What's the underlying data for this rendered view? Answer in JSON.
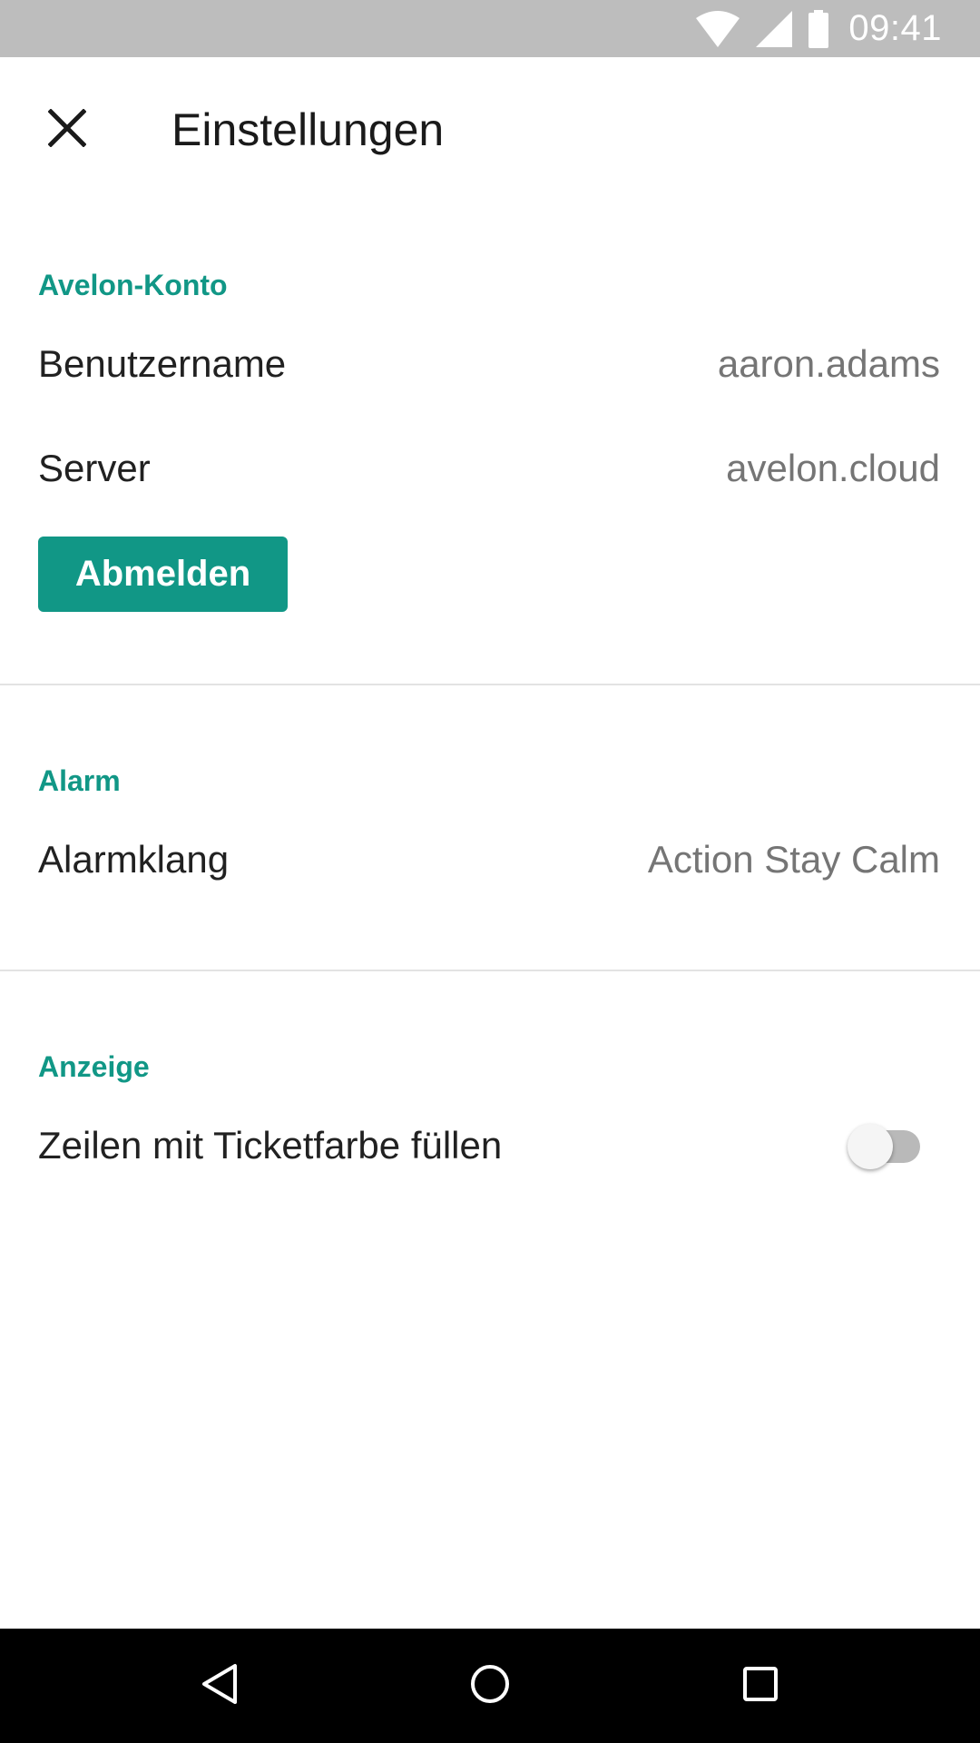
{
  "status_bar": {
    "time": "09:41",
    "icons": [
      "wifi-icon",
      "signal-icon",
      "battery-icon"
    ]
  },
  "app_bar": {
    "close_icon": "close-icon",
    "title": "Einstellungen"
  },
  "sections": {
    "account": {
      "header": "Avelon-Konto",
      "username_label": "Benutzername",
      "username_value": "aaron.adams",
      "server_label": "Server",
      "server_value": "avelon.cloud",
      "logout_label": "Abmelden"
    },
    "alarm": {
      "header": "Alarm",
      "sound_label": "Alarmklang",
      "sound_value": "Action Stay Calm"
    },
    "display": {
      "header": "Anzeige",
      "fill_rows_label": "Zeilen mit Ticketfarbe füllen",
      "fill_rows_enabled": false
    }
  },
  "nav_bar": {
    "icons": [
      "back-icon",
      "home-icon",
      "recents-icon"
    ]
  },
  "colors": {
    "accent": "#119786",
    "status_bar": "#bdbdbd",
    "nav_bar": "#000000",
    "primary_text": "#212121",
    "secondary_text": "#757575"
  }
}
